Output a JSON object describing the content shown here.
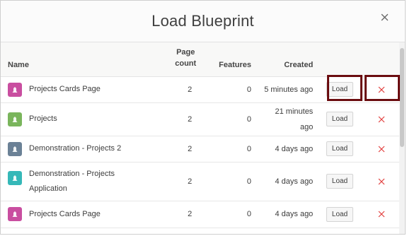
{
  "dialog": {
    "title": "Load Blueprint"
  },
  "table": {
    "columns": {
      "name": "Name",
      "page_count": "Page count",
      "features": "Features",
      "created": "Created"
    },
    "rows": [
      {
        "name": "Projects Cards Page",
        "page_count": "2",
        "features": "0",
        "created": "5 minutes ago",
        "icon_color": "#c94ea0",
        "load_label": "Load"
      },
      {
        "name": "Projects",
        "page_count": "2",
        "features": "0",
        "created": "21 minutes ago",
        "icon_color": "#7ab55c",
        "load_label": "Load"
      },
      {
        "name": "Demonstration - Projects 2",
        "page_count": "2",
        "features": "0",
        "created": "4 days ago",
        "icon_color": "#6b8196",
        "load_label": "Load"
      },
      {
        "name": "Demonstration - Projects Application",
        "page_count": "2",
        "features": "0",
        "created": "4 days ago",
        "icon_color": "#35b8b8",
        "load_label": "Load"
      },
      {
        "name": "Projects Cards Page",
        "page_count": "2",
        "features": "0",
        "created": "4 days ago",
        "icon_color": "#c94ea0",
        "load_label": "Load"
      }
    ]
  },
  "icons": {
    "close": "close-icon",
    "delete": "delete-icon",
    "app": "app-icon"
  },
  "colors": {
    "delete_red": "#e2403f",
    "highlight": "#6b0d10"
  }
}
